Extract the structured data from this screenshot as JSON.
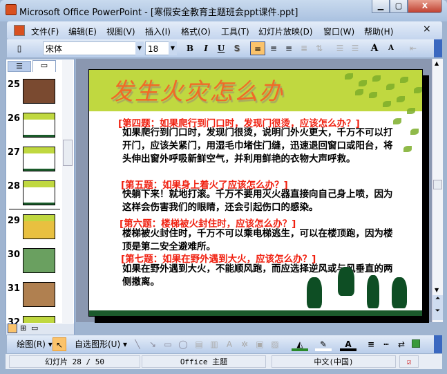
{
  "window": {
    "title": "Microsoft Office PowerPoint - [寒假安全教育主题班会ppt课件.ppt]",
    "minimize": "▁",
    "maximize": "▢",
    "close": "X"
  },
  "menu": [
    "文件(F)",
    "编辑(E)",
    "视图(V)",
    "插入(I)",
    "格式(O)",
    "工具(T)",
    "幻灯片放映(D)",
    "窗口(W)",
    "帮助(H)"
  ],
  "menu_close": "×",
  "format": {
    "font": "宋体",
    "size": "18",
    "bold": "B",
    "italic": "I",
    "underline": "U",
    "shadow": "S",
    "grow": "A",
    "shrink": "A"
  },
  "panel": {
    "close": "×",
    "slides": [
      "25",
      "26",
      "27",
      "28",
      "29",
      "30",
      "31",
      "32"
    ],
    "selected": "28"
  },
  "slide": {
    "title": "发生火灾怎么办",
    "items": [
      {
        "q": "[第四题：如果爬行到门口时，发现门很烫，应该怎么办？]",
        "a": "如果爬行到门口时，发现门很烫，说明门外火更大，千万不可以打开门，应该关紧门，用湿毛巾堵住门缝，迅速退回窗口或阳台，将头伸出窗外呼吸新鲜空气，并利用鲜艳的衣物大声呼救。"
      },
      {
        "q": "[第五题：如果身上着火了应该怎么办？]",
        "a": "快躺下来！就地打滚。千万不要用灭火器直接向自己身上喷，因为这样会伤害我们的眼睛，还会引起伤口的感染。"
      },
      {
        "q": "[第六题：楼梯被火封住时，应该怎么办？]",
        "a": "楼梯被火封住时，千万不可以乘电梯逃生，可以在楼顶跑，因为楼顶是第二安全避难所。"
      },
      {
        "q": "[第七题：如果在野外遇到大火，应该怎么办？]",
        "a": "如果在野外遇到大火，不能顺风跑，而应选择逆风或与风垂直的两侧撤离。"
      }
    ]
  },
  "drawing": {
    "draw": "绘图(R)",
    "autoshapes": "自选图形(U)"
  },
  "status": {
    "slide": "幻灯片 28 / 50",
    "theme": "Office 主题",
    "language": "中文(中国)"
  },
  "colors": {
    "accent": "#c0d840",
    "question": "#f02010",
    "footer": "#1b5a2c"
  }
}
